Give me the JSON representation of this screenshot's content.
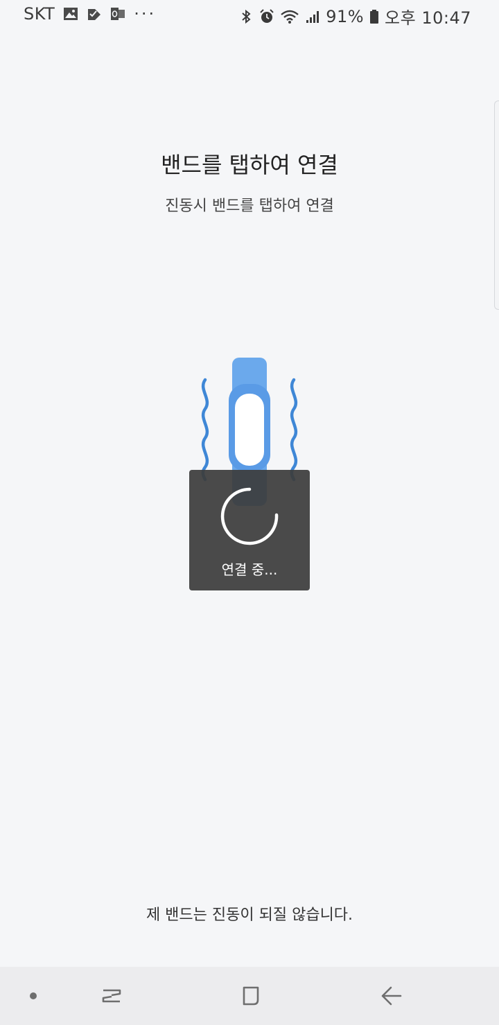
{
  "status_bar": {
    "carrier": "SKT",
    "more": "···",
    "battery_pct": "91%",
    "time": "오후 10:47",
    "left_icons": [
      "gallery-icon",
      "check-task-icon",
      "outlook-icon"
    ],
    "right_icons": [
      "bluetooth-icon",
      "alarm-icon",
      "wifi-icon",
      "signal-icon",
      "battery-icon"
    ]
  },
  "main": {
    "title": "밴드를 탭하여 연결",
    "subtitle": "진동시 밴드를 탭하여 연결",
    "illustration": "vibrating-band-icon",
    "bottom_message": "제 밴드는 진동이 되질 않습니다."
  },
  "dialog": {
    "loading_text": "연결 중..."
  },
  "nav_bar": {
    "buttons": [
      "home-dot-icon",
      "recent-apps-icon",
      "home-square-icon",
      "back-arrow-icon"
    ]
  },
  "colors": {
    "background": "#f5f6f8",
    "band_blue": "#6ba9ec",
    "wave_blue": "#3f87d6",
    "dialog_bg": "#3c3c3c",
    "nav_bg": "#ececee"
  }
}
